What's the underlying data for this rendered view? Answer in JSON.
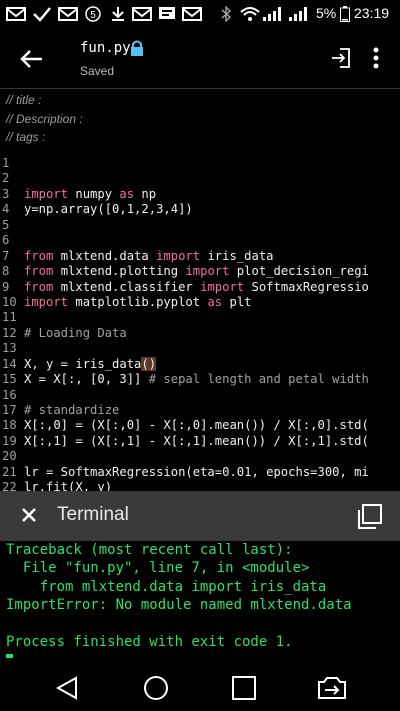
{
  "statusbar": {
    "battery": "5%",
    "time": "23:19",
    "notification_badge": "5"
  },
  "appbar": {
    "file_name": "fun.py",
    "save_status": "Saved"
  },
  "meta_comments": [
    "// title :",
    "// Description :",
    "// tags :"
  ],
  "editor": {
    "lines": [
      {
        "n": "1",
        "segs": []
      },
      {
        "n": "2",
        "segs": []
      },
      {
        "n": "3",
        "segs": [
          {
            "t": "import",
            "c": "kw"
          },
          {
            "t": " numpy "
          },
          {
            "t": "as",
            "c": "kw"
          },
          {
            "t": " np"
          }
        ]
      },
      {
        "n": "4",
        "segs": [
          {
            "t": "y=np.array([0,1,2,3,4])"
          }
        ]
      },
      {
        "n": "5",
        "segs": []
      },
      {
        "n": "6",
        "segs": []
      },
      {
        "n": "7",
        "segs": [
          {
            "t": "from",
            "c": "kw"
          },
          {
            "t": " mlxtend.data "
          },
          {
            "t": "import",
            "c": "kw"
          },
          {
            "t": " iris_data"
          }
        ]
      },
      {
        "n": "8",
        "segs": [
          {
            "t": "from",
            "c": "kw"
          },
          {
            "t": " mlxtend.plotting "
          },
          {
            "t": "import",
            "c": "kw"
          },
          {
            "t": " plot_decision_regi"
          }
        ]
      },
      {
        "n": "9",
        "segs": [
          {
            "t": "from",
            "c": "kw"
          },
          {
            "t": " mlxtend.classifier "
          },
          {
            "t": "import",
            "c": "kw"
          },
          {
            "t": " SoftmaxRegressio"
          }
        ]
      },
      {
        "n": "10",
        "segs": [
          {
            "t": "import",
            "c": "kw"
          },
          {
            "t": " matplotlib.pyplot "
          },
          {
            "t": "as",
            "c": "kw"
          },
          {
            "t": " plt"
          }
        ]
      },
      {
        "n": "11",
        "segs": []
      },
      {
        "n": "12",
        "segs": [
          {
            "t": "# Loading Data",
            "c": "cm"
          }
        ]
      },
      {
        "n": "13",
        "segs": []
      },
      {
        "n": "14",
        "segs": [
          {
            "t": "X, y = iris_data"
          },
          {
            "t": "()",
            "c": "paren-hl"
          }
        ]
      },
      {
        "n": "15",
        "segs": [
          {
            "t": "X = X[:, [0, 3]] "
          },
          {
            "t": "# sepal length and petal width",
            "c": "cm"
          }
        ]
      },
      {
        "n": "16",
        "segs": []
      },
      {
        "n": "17",
        "segs": [
          {
            "t": "# standardize",
            "c": "cm"
          }
        ]
      },
      {
        "n": "18",
        "segs": [
          {
            "t": "X[:,0] = (X[:,0] - X[:,0].mean()) / X[:,0].std("
          }
        ]
      },
      {
        "n": "19",
        "segs": [
          {
            "t": "X[:,1] = (X[:,1] - X[:,1].mean()) / X[:,1].std("
          }
        ]
      },
      {
        "n": "20",
        "segs": []
      },
      {
        "n": "21",
        "segs": [
          {
            "t": "lr = SoftmaxRegression(eta=0.01, epochs=300, mi"
          }
        ]
      },
      {
        "n": "22",
        "segs": [
          {
            "t": "lr.fit(X, y)"
          }
        ]
      }
    ]
  },
  "terminal": {
    "title": "Terminal",
    "output": [
      "Traceback (most recent call last):",
      "  File \"fun.py\", line 7, in <module>",
      "    from mlxtend.data import iris_data",
      "ImportError: No module named mlxtend.data",
      "",
      "Process finished with exit code 1."
    ]
  },
  "colors": {
    "keyword": "#f26f9b",
    "terminal_text": "#2ae068",
    "terminal_bar": "#3a3a3a",
    "lock": "#4fc3f7"
  },
  "icons": {
    "back": "arrow-left-icon",
    "lock": "lock-icon",
    "export": "export-icon",
    "more": "more-vertical-icon",
    "close": "close-icon",
    "copy": "copy-icon",
    "nav_back": "triangle-back-icon",
    "nav_home": "circle-home-icon",
    "nav_recents": "square-recents-icon",
    "nav_screen": "screen-switch-icon"
  }
}
